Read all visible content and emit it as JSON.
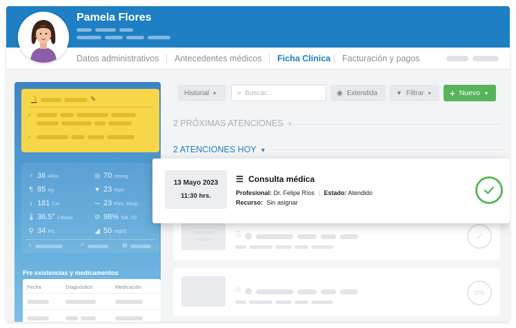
{
  "patient": {
    "name": "Pamela Flores"
  },
  "tabs": [
    {
      "label": "Datos administrativos"
    },
    {
      "label": "Antecedentes médicos"
    },
    {
      "label": "Ficha Clínica",
      "active": true
    },
    {
      "label": "Facturación y pagos"
    }
  ],
  "vitals": [
    {
      "icon": "♂",
      "value": "36",
      "unit": "Años"
    },
    {
      "icon": "◎",
      "value": "70",
      "unit": "mmHg"
    },
    {
      "icon": "¶",
      "value": "85",
      "unit": "Kg"
    },
    {
      "icon": "♥",
      "value": "23",
      "unit": "Ppm"
    },
    {
      "icon": "↕",
      "value": "181",
      "unit": "Cm"
    },
    {
      "icon": "⏦",
      "value": "23",
      "unit": "Frec. Resp."
    },
    {
      "icon": "🌡",
      "value": "36.5°",
      "unit": "Celcius"
    },
    {
      "icon": "⊘",
      "value": "98%",
      "unit": "Sat. O2"
    },
    {
      "icon": "⚲",
      "value": "34",
      "unit": "Pts."
    },
    {
      "icon": "◢",
      "value": "50",
      "unit": "mg/dl"
    }
  ],
  "sidebar": {
    "pre_title": "Pre existencias y medicamentos",
    "table_headers": [
      "Fecha",
      "Diagnóstico",
      "Medicación"
    ]
  },
  "toolbar": {
    "historial": "Historial",
    "search_placeholder": "Buscar...",
    "extendida": "Extendida",
    "filtrar": "Filtrar",
    "nuevo": "Nuevo"
  },
  "sections": {
    "upcoming": "2 PRÓXIMAS ATENCIONES",
    "today": "2 ATENCIONES HOY"
  },
  "consulta": {
    "date": "13 Mayo 2023",
    "time": "11:30 hrs.",
    "title": "Consulta médica",
    "profesional_label": "Profesional:",
    "profesional": "Dr. Felipe Ríos",
    "estado_label": "Estado:",
    "estado": "Atendido",
    "recurso_label": "Recurso:",
    "recurso": "Sin asignar"
  },
  "ghost_progress": "0%",
  "colors": {
    "brand": "#1f7fc4",
    "accent_green": "#58b45a",
    "alert_yellow": "#f7d64a"
  }
}
